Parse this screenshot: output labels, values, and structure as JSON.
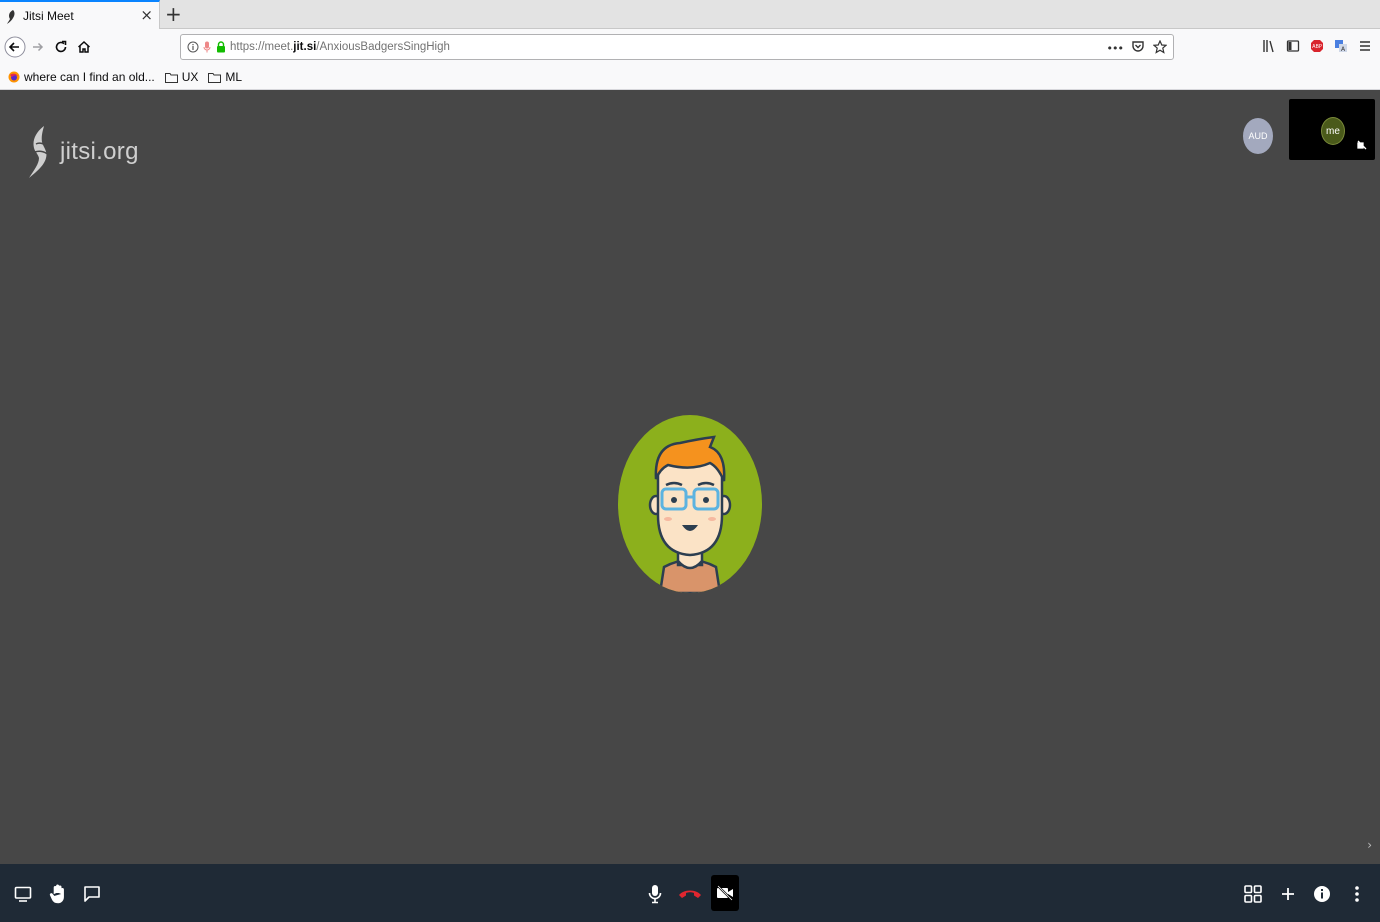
{
  "browser": {
    "tab_title": "Jitsi Meet",
    "tab_close": "×",
    "new_tab": "+",
    "url": {
      "prefix": "https://meet.",
      "domain": "jit.si",
      "path": "/AnxiousBadgersSingHigh"
    },
    "url_actions": "•••"
  },
  "bookmarks": [
    {
      "label": "where can I find an old..."
    },
    {
      "label": "UX"
    },
    {
      "label": "ML"
    }
  ],
  "meeting": {
    "logo_text": "jitsi.org",
    "remote_participant_initials": "AUD",
    "local_participant_initials": "me",
    "filmstrip_toggle": "›"
  },
  "colors": {
    "meeting_background": "#474747",
    "toolbox_background": "#1f2a36",
    "avatar_green": "#8cb01c",
    "hangup_red": "#e0262f"
  }
}
